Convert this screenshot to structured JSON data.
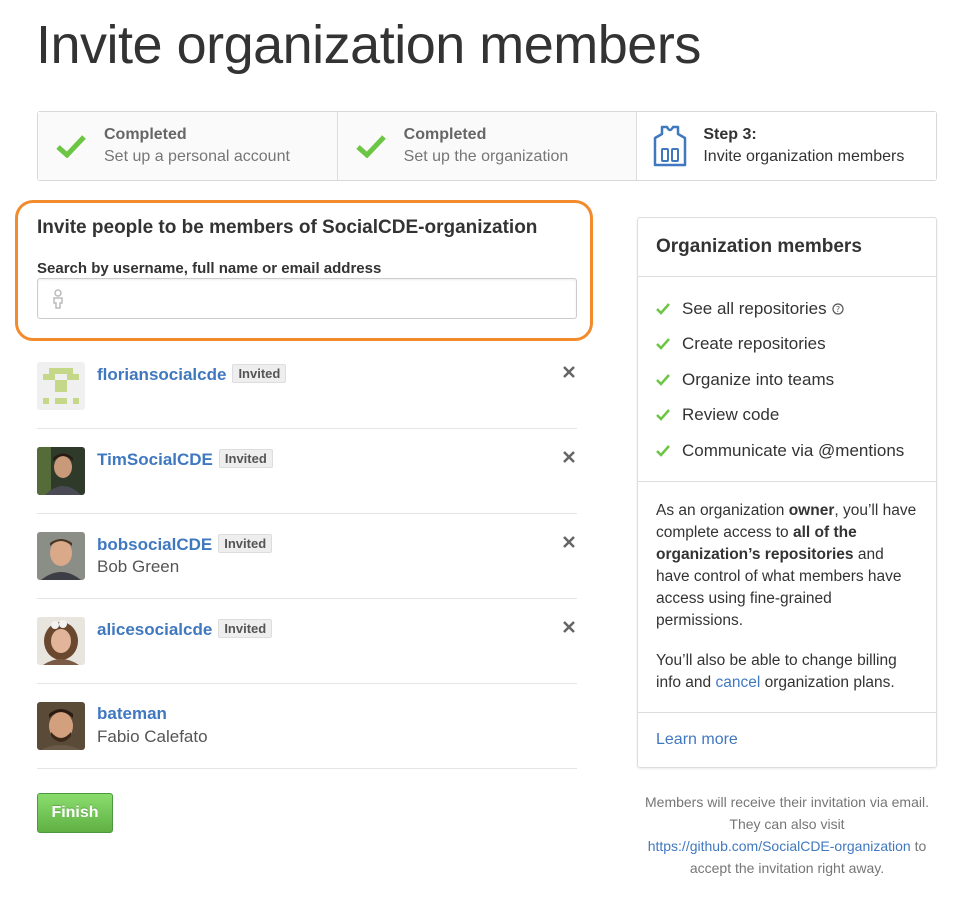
{
  "page": {
    "title": "Invite organization members"
  },
  "steps": [
    {
      "state": "Completed",
      "label": "Set up a personal account"
    },
    {
      "state": "Completed",
      "label": "Set up the organization"
    },
    {
      "state": "Step 3:",
      "label": "Invite organization members"
    }
  ],
  "invite": {
    "title": "Invite people to be members of SocialCDE-organization",
    "search_label": "Search by username, full name or email address",
    "search_value": ""
  },
  "members": [
    {
      "username": "floriansocialcde",
      "badge": "Invited",
      "full_name": "",
      "removable": true
    },
    {
      "username": "TimSocialCDE",
      "badge": "Invited",
      "full_name": "",
      "removable": true
    },
    {
      "username": "bobsocialCDE",
      "badge": "Invited",
      "full_name": "Bob Green",
      "removable": true
    },
    {
      "username": "alicesocialcde",
      "badge": "Invited",
      "full_name": "",
      "removable": true
    },
    {
      "username": "bateman",
      "badge": "",
      "full_name": "Fabio Calefato",
      "removable": false
    }
  ],
  "finish_label": "Finish",
  "sidebar": {
    "title": "Organization members",
    "features": [
      "See all repositories",
      "Create repositories",
      "Organize into teams",
      "Review code",
      "Communicate via @mentions"
    ],
    "desc1_a": "As an organization ",
    "desc1_b": "owner",
    "desc1_c": ", you’ll have complete access to ",
    "desc1_d": "all of the organization’s repositories",
    "desc1_e": " and have control of what members have access using fine-grained permissions.",
    "desc2_a": "You’ll also be able to change billing info and ",
    "desc2_link": "cancel",
    "desc2_b": " organization plans.",
    "learn_more": "Learn more"
  },
  "footnote": {
    "text_a": "Members will receive their invitation via email. They can also visit ",
    "link": "https://github.com/SocialCDE-organization",
    "text_b": " to accept the invitation right away."
  },
  "colors": {
    "accent_link": "#4078c0",
    "check_green": "#6cc644",
    "highlight_orange": "#f28b2c",
    "finish_green": "#60b044"
  },
  "icons": [
    "check-icon",
    "jersey-icon",
    "person-icon",
    "close-icon",
    "question-icon"
  ]
}
